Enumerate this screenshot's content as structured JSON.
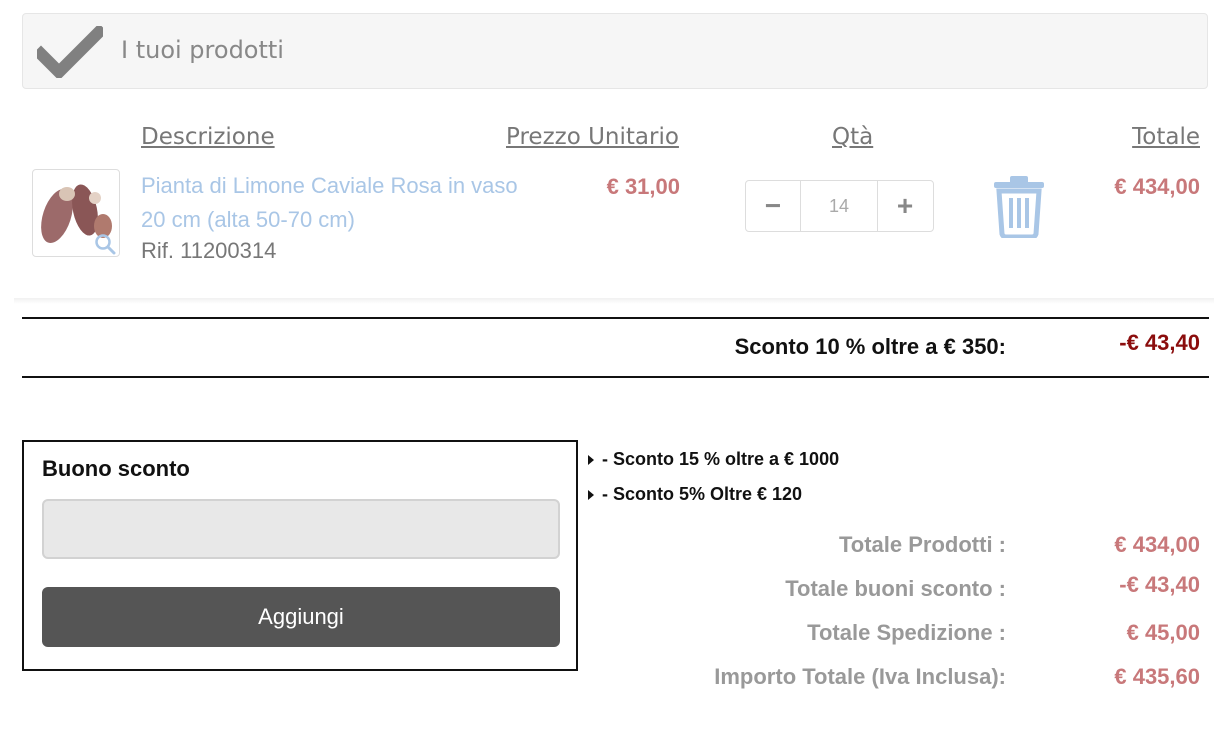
{
  "header": {
    "title": "I tuoi prodotti",
    "icon": "check-icon"
  },
  "columns": {
    "description": "Descrizione",
    "unit_price": "Prezzo Unitario",
    "qty": "Qtà",
    "total": "Totale"
  },
  "item": {
    "name": "Pianta di Limone Caviale Rosa in vaso 20 cm (alta 50-70 cm)",
    "ref": "Rif. 11200314",
    "unit_price": "€ 31,00",
    "qty_value": "14",
    "minus": "−",
    "plus": "+",
    "total": "€ 434,00"
  },
  "discount": {
    "label": "Sconto 10 % oltre a € 350:",
    "value": "-€ 43,40"
  },
  "coupon": {
    "title": "Buono sconto",
    "input_value": "",
    "button_label": "Aggiungi"
  },
  "promos": [
    "- Sconto 15 % oltre a € 1000",
    "- Sconto 5% Oltre € 120"
  ],
  "summary": [
    {
      "label": "Totale Prodotti :",
      "value": "€ 434,00"
    },
    {
      "label": "Totale buoni sconto :",
      "value": "-€ 43,40"
    },
    {
      "label": "Totale Spedizione :",
      "value": "€ 45,00"
    },
    {
      "label": "Importo Totale (Iva Inclusa):",
      "value": "€ 435,60"
    }
  ],
  "colors": {
    "price": "#c8787a",
    "discount": "#8b0d0d",
    "link": "#a9c6e6",
    "button": "#555555"
  }
}
